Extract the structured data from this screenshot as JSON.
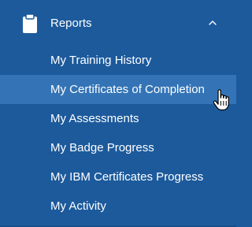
{
  "section": {
    "title": "Reports",
    "icon": "clipboard-icon",
    "expanded": true,
    "chevron_icon": "chevron-up-icon"
  },
  "items": [
    {
      "label": "My Training History"
    },
    {
      "label": "My Certificates of Completion"
    },
    {
      "label": "My Assessments"
    },
    {
      "label": "My Badge Progress"
    },
    {
      "label": "My IBM Certificates Progress"
    },
    {
      "label": "My Activity"
    }
  ],
  "hovered_item": "My Certificates of Completion",
  "colors": {
    "background": "#1c5a9c",
    "hover": "#3474b6",
    "text": "#ffffff"
  },
  "cursor_icon": "hand-pointer-icon"
}
